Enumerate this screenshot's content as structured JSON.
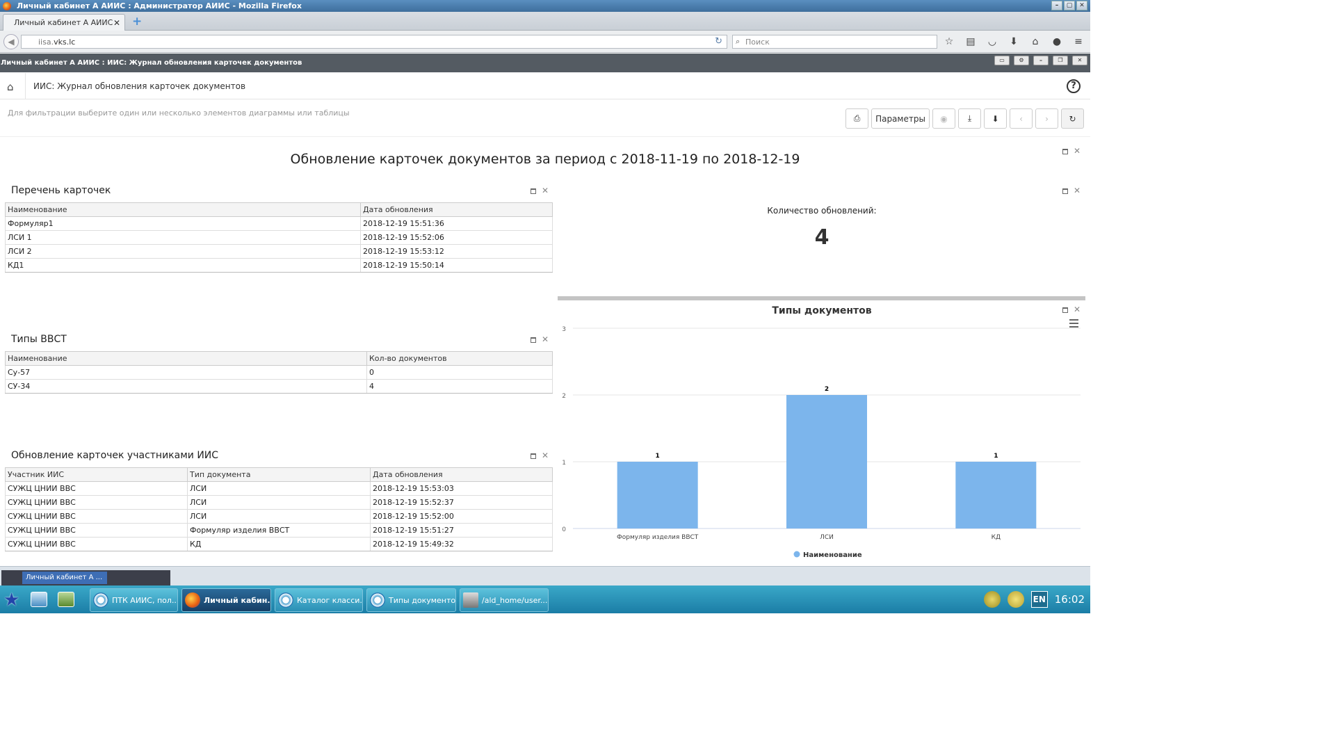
{
  "browser": {
    "window_title": "Личный кабинет А АИИС : Администратор АИИС - Mozilla Firefox",
    "tab_label": "Личный кабинет А АИИС ...",
    "url_prefix": "iisa.",
    "url_domain": "vks.lc",
    "search_placeholder": "Поиск"
  },
  "app": {
    "header_title": "Личный кабинет А АИИС : ИИС: Журнал обновления карточек документов",
    "page_title": "ИИС: Журнал обновления карточек документов",
    "filter_hint": "Для фильтрации выберите один или несколько элементов диаграммы или таблицы",
    "params_label": "Параметры"
  },
  "dashboard": {
    "title": "Обновление карточек документов за период с 2018-11-19 по 2018-12-19",
    "cards": {
      "title": "Перечень карточек",
      "columns": [
        "Наименование",
        "Дата обновления"
      ],
      "rows": [
        [
          "Формуляр1",
          "2018-12-19 15:51:36"
        ],
        [
          "ЛСИ 1",
          "2018-12-19 15:52:06"
        ],
        [
          "ЛСИ 2",
          "2018-12-19 15:53:12"
        ],
        [
          "КД1",
          "2018-12-19 15:50:14"
        ]
      ]
    },
    "counter": {
      "label": "Количество обновлений:",
      "value": "4"
    },
    "vvst": {
      "title": "Типы ВВСТ",
      "columns": [
        "Наименование",
        "Кол-во документов"
      ],
      "rows": [
        [
          "Су-57",
          "0"
        ],
        [
          "СУ-34",
          "4"
        ]
      ]
    },
    "updates": {
      "title": "Обновление карточек участниками ИИС",
      "columns": [
        "Участник ИИС",
        "Тип документа",
        "Дата обновления"
      ],
      "rows": [
        [
          "СУЖЦ ЦНИИ ВВС",
          "ЛСИ",
          "2018-12-19 15:53:03"
        ],
        [
          "СУЖЦ ЦНИИ ВВС",
          "ЛСИ",
          "2018-12-19 15:52:37"
        ],
        [
          "СУЖЦ ЦНИИ ВВС",
          "ЛСИ",
          "2018-12-19 15:52:00"
        ],
        [
          "СУЖЦ ЦНИИ ВВС",
          "Формуляр изделия ВВСТ",
          "2018-12-19 15:51:27"
        ],
        [
          "СУЖЦ ЦНИИ ВВС",
          "КД",
          "2018-12-19 15:49:32"
        ]
      ]
    }
  },
  "chart_data": {
    "type": "bar",
    "title": "Типы документов",
    "categories": [
      "Формуляр изделия ВВСТ",
      "ЛСИ",
      "КД"
    ],
    "series": [
      {
        "name": "Наименование",
        "values": [
          1,
          2,
          1
        ],
        "color": "#7cb5ec"
      }
    ],
    "ylim": [
      0,
      3
    ],
    "yticks": [
      0,
      1,
      2,
      3
    ],
    "grid": true,
    "legend": "bottom-center"
  },
  "os": {
    "window_task_label": "Личный кабинет А ...",
    "taskbar": [
      "ПТК АИИС, пол...",
      "Личный кабин...",
      "Каталог класси...",
      "Типы документов",
      "/ald_home/user..."
    ],
    "lang": "EN",
    "clock": "16:02"
  }
}
